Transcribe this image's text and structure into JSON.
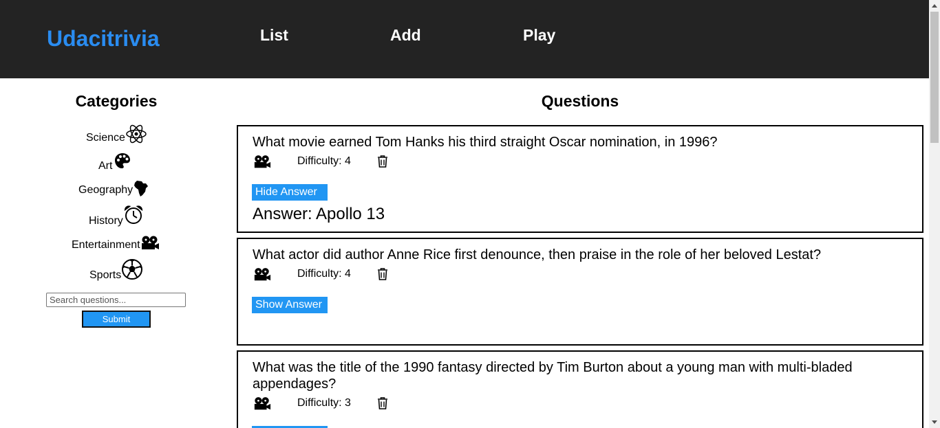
{
  "header": {
    "brand": "Udacitrivia",
    "nav": [
      "List",
      "Add",
      "Play"
    ]
  },
  "sidebar": {
    "title": "Categories",
    "categories": [
      {
        "label": "Science",
        "icon": "science-icon"
      },
      {
        "label": "Art",
        "icon": "art-icon"
      },
      {
        "label": "Geography",
        "icon": "geography-icon"
      },
      {
        "label": "History",
        "icon": "history-icon"
      },
      {
        "label": "Entertainment",
        "icon": "entertainment-icon"
      },
      {
        "label": "Sports",
        "icon": "sports-icon"
      }
    ],
    "search": {
      "placeholder": "Search questions...",
      "value": ""
    },
    "submit_label": "Submit"
  },
  "main": {
    "title": "Questions",
    "questions": [
      {
        "text": "What movie earned Tom Hanks his third straight Oscar nomination, in 1996?",
        "category_icon": "entertainment-icon",
        "difficulty": "Difficulty: 4",
        "button": "Hide Answer",
        "answer": "Answer: Apollo 13"
      },
      {
        "text": "What actor did author Anne Rice first denounce, then praise in the role of her beloved Lestat?",
        "category_icon": "entertainment-icon",
        "difficulty": "Difficulty: 4",
        "button": "Show Answer",
        "answer": ""
      },
      {
        "text": "What was the title of the 1990 fantasy directed by Tim Burton about a young man with multi-bladed appendages?",
        "category_icon": "entertainment-icon",
        "difficulty": "Difficulty: 3",
        "button": "",
        "answer": ""
      }
    ]
  },
  "colors": {
    "navbar_bg": "#232323",
    "brand": "#2a8cf0",
    "button_bg": "#2196f3"
  }
}
